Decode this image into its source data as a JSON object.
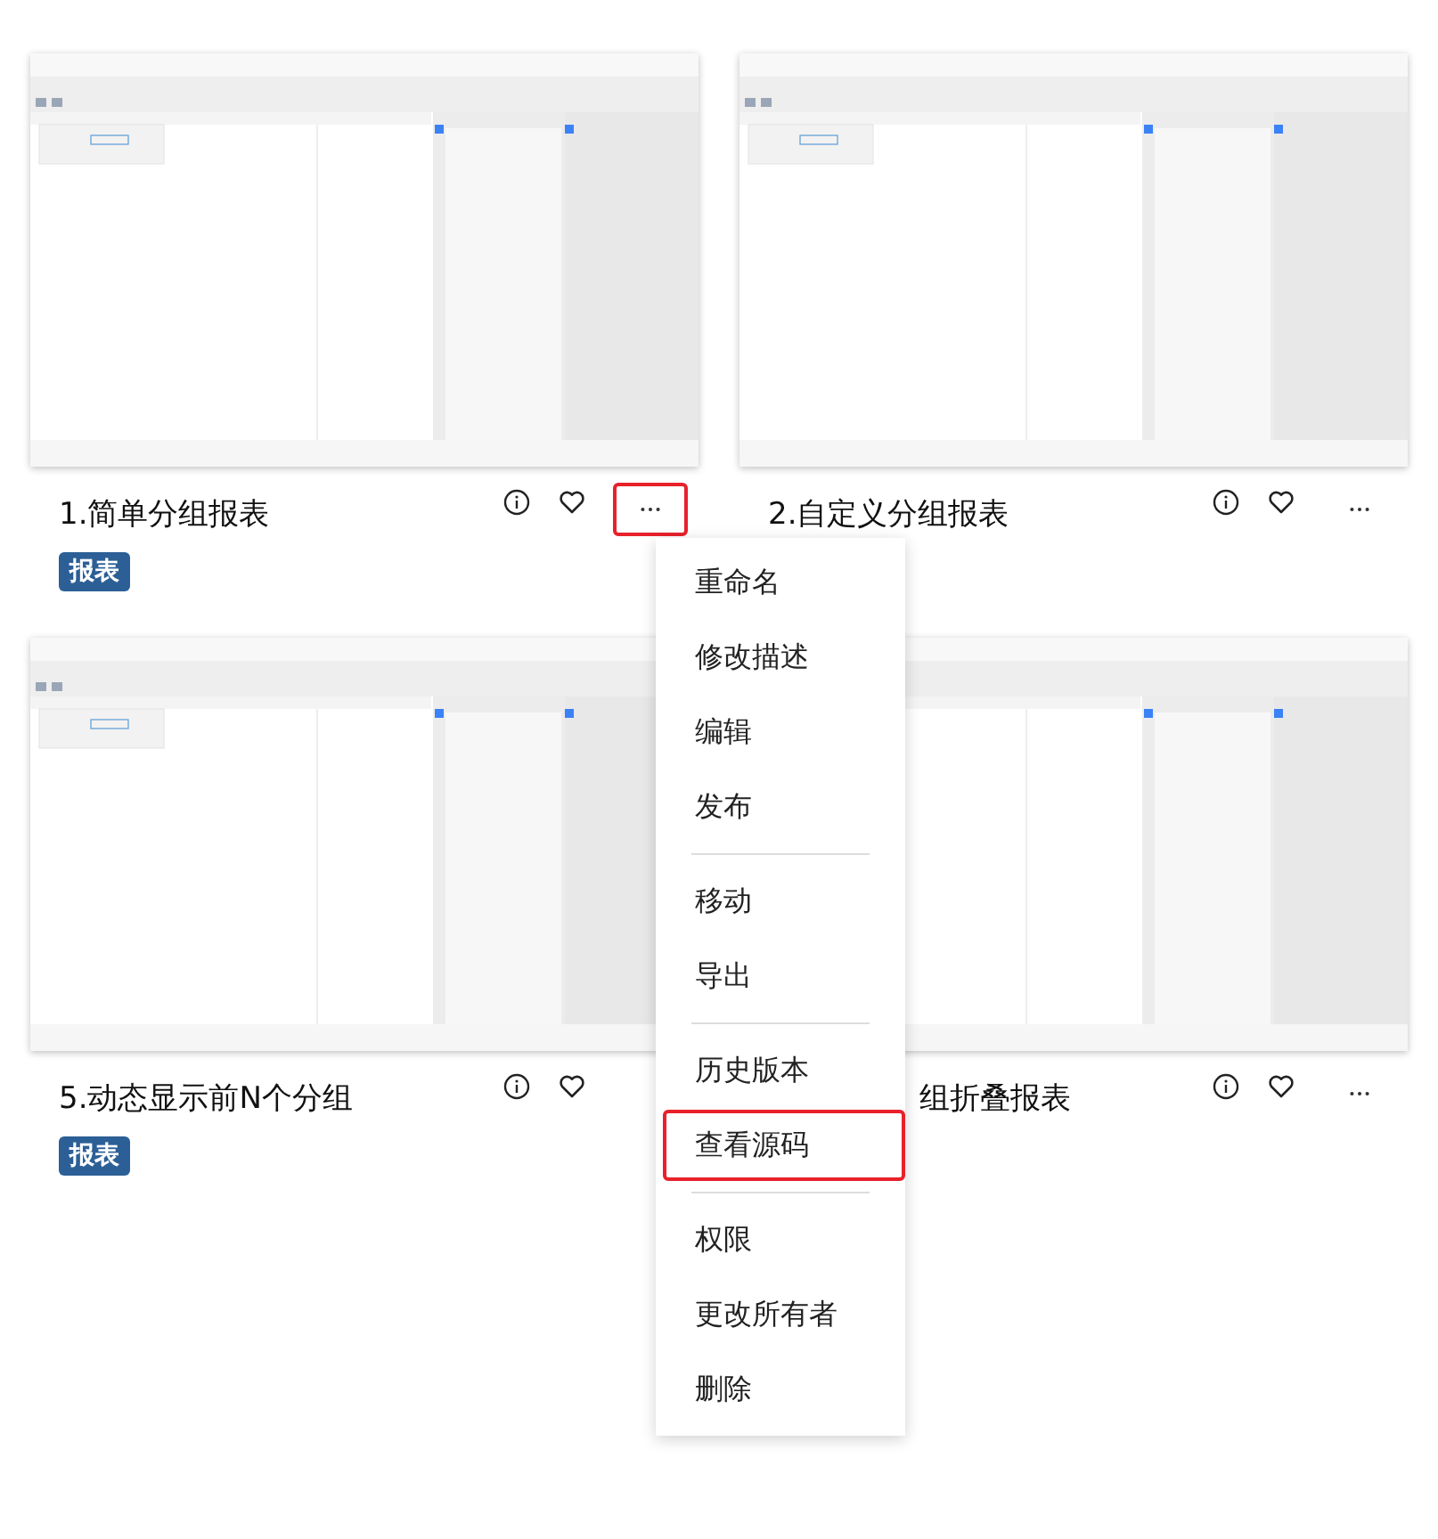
{
  "cards": [
    {
      "title": "1.简单分组报表",
      "tag": "报表",
      "more_button": {
        "selected": true
      }
    },
    {
      "title": "2.自定义分组报表",
      "more_button": {
        "selected": false
      }
    },
    {
      "title": "5.动态显示前N个分组",
      "tag": "报表"
    },
    {
      "title": "组折叠报表",
      "more_button": {
        "selected": false
      }
    }
  ],
  "context_menu": {
    "groups": [
      {
        "items": [
          {
            "label": "重命名",
            "selected": false
          },
          {
            "label": "修改描述",
            "selected": false
          },
          {
            "label": "编辑",
            "selected": false
          },
          {
            "label": "发布",
            "selected": false
          }
        ]
      },
      {
        "items": [
          {
            "label": "移动",
            "selected": false
          },
          {
            "label": "导出",
            "selected": false
          }
        ]
      },
      {
        "items": [
          {
            "label": "历史版本",
            "selected": false
          },
          {
            "label": "查看源码",
            "selected": true
          }
        ]
      },
      {
        "items": [
          {
            "label": "权限",
            "selected": false
          },
          {
            "label": "更改所有者",
            "selected": false
          },
          {
            "label": "删除",
            "selected": false
          }
        ]
      }
    ]
  }
}
